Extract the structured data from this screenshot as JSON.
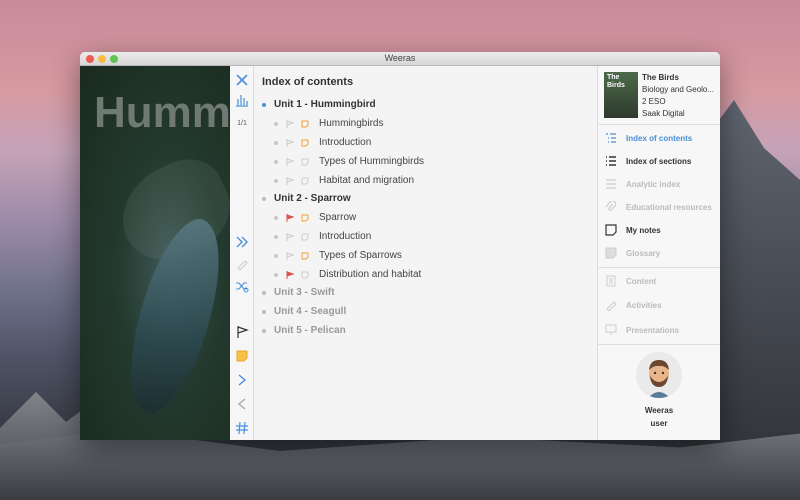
{
  "window": {
    "title": "Weeras"
  },
  "background_image": {
    "title": "Humm"
  },
  "toolbar": {
    "page_indicator": "1/1",
    "icons": [
      "close-icon",
      "chart-icon",
      "double-chevron-right-icon",
      "pencil-icon",
      "shuffle-icon",
      "flag-icon",
      "note-icon",
      "chevron-right-icon",
      "chevron-left-icon",
      "hash-icon"
    ]
  },
  "index": {
    "title": "Index of contents",
    "units": [
      {
        "label": "Unit 1 - Hummingbird",
        "state": "active",
        "sections": [
          {
            "label": "Hummingbirds",
            "flag": "off",
            "note": "on"
          },
          {
            "label": "Introduction",
            "flag": "off",
            "note": "on"
          },
          {
            "label": "Types of Hummingbirds",
            "flag": "off",
            "note": "off"
          },
          {
            "label": "Habitat and migration",
            "flag": "off",
            "note": "off"
          }
        ]
      },
      {
        "label": "Unit 2 - Sparrow",
        "state": "enabled",
        "sections": [
          {
            "label": "Sparrow",
            "flag": "on",
            "note": "on"
          },
          {
            "label": "Introduction",
            "flag": "off",
            "note": "off"
          },
          {
            "label": "Types of Sparrows",
            "flag": "off",
            "note": "on"
          },
          {
            "label": "Distribution and habitat",
            "flag": "on",
            "note": "off"
          }
        ]
      },
      {
        "label": "Unit 3 - Swift",
        "state": "disabled",
        "sections": []
      },
      {
        "label": "Unit 4 - Seagull",
        "state": "disabled",
        "sections": []
      },
      {
        "label": "Unit 5 - Pelican",
        "state": "disabled",
        "sections": []
      }
    ]
  },
  "book": {
    "cover_text": "The Birds",
    "title": "The Birds",
    "subject": "Biology and Geolo...",
    "level": "2 ESO",
    "publisher": "Saak Digital"
  },
  "sidebar": {
    "nav": [
      {
        "label": "Index of contents",
        "icon": "list-icon",
        "state": "active"
      },
      {
        "label": "Index of sections",
        "icon": "list-bullets-icon",
        "state": "enabled"
      },
      {
        "label": "Analytic index",
        "icon": "lines-icon",
        "state": "disabled"
      },
      {
        "label": "Educational resources",
        "icon": "paperclip-icon",
        "state": "disabled"
      },
      {
        "label": "My notes",
        "icon": "note-icon",
        "state": "enabled"
      },
      {
        "label": "Glossary",
        "icon": "glossary-icon",
        "state": "disabled"
      },
      {
        "label": "Content",
        "icon": "document-icon",
        "state": "disabled"
      },
      {
        "label": "Activities",
        "icon": "pencil-icon",
        "state": "disabled"
      },
      {
        "label": "Presentations",
        "icon": "presentation-icon",
        "state": "disabled"
      }
    ],
    "user": {
      "name": "Weeras",
      "role": "user"
    }
  },
  "colors": {
    "accent": "#4a90d9",
    "flag_red": "#d9534f",
    "note_orange": "#f0a030",
    "disabled": "#bbbbbb"
  }
}
